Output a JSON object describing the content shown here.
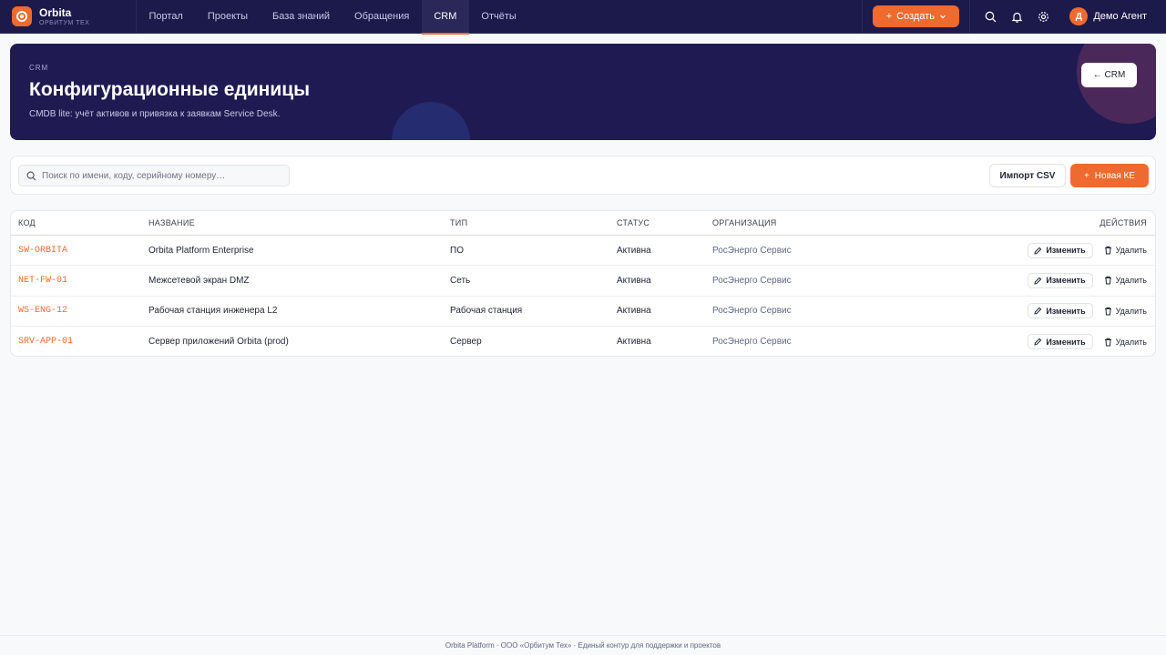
{
  "brand": {
    "name": "Orbita",
    "subtitle": "ОРБИТУМ ТЕХ"
  },
  "nav": [
    {
      "label": "Портал"
    },
    {
      "label": "Проекты"
    },
    {
      "label": "База знаний"
    },
    {
      "label": "Обращения"
    },
    {
      "label": "CRM",
      "active": true
    },
    {
      "label": "Отчёты"
    }
  ],
  "header": {
    "create_label": "Создать",
    "user": {
      "initial": "Д",
      "name": "Демо Агент"
    }
  },
  "hero": {
    "kicker": "CRM",
    "title": "Конфигурационные единицы",
    "subtitle": "CMDB lite: учёт активов и привязка к заявкам Service Desk.",
    "back_label": "← CRM"
  },
  "toolbar": {
    "search_placeholder": "Поиск по имени, коду, серийному номеру…",
    "import_label": "Импорт CSV",
    "new_label": "Новая КЕ"
  },
  "table": {
    "columns": [
      "КОД",
      "НАЗВАНИЕ",
      "ТИП",
      "СТАТУС",
      "ОРГАНИЗАЦИЯ",
      "ДЕЙСТВИЯ"
    ],
    "edit_label": "Изменить",
    "delete_label": "Удалить",
    "rows": [
      {
        "code": "SW-ORBITA",
        "name": "Orbita Platform Enterprise",
        "type": "ПО",
        "status": "Активна",
        "org": "РосЭнерго Сервис"
      },
      {
        "code": "NET-FW-01",
        "name": "Межсетевой экран DMZ",
        "type": "Сеть",
        "status": "Активна",
        "org": "РосЭнерго Сервис"
      },
      {
        "code": "WS-ENG-12",
        "name": "Рабочая станция инженера L2",
        "type": "Рабочая станция",
        "status": "Активна",
        "org": "РосЭнерго Сервис"
      },
      {
        "code": "SRV-APP-01",
        "name": "Сервер приложений Orbita (prod)",
        "type": "Сервер",
        "status": "Активна",
        "org": "РосЭнерго Сервис"
      }
    ]
  },
  "footer": {
    "text": "Orbita Platform · ООО «Орбитум Тех» · Единый контур для поддержки и проектов"
  },
  "colors": {
    "accent": "#ee6a2e",
    "topbar": "#1c1a4a",
    "hero": "#1f1b52"
  }
}
